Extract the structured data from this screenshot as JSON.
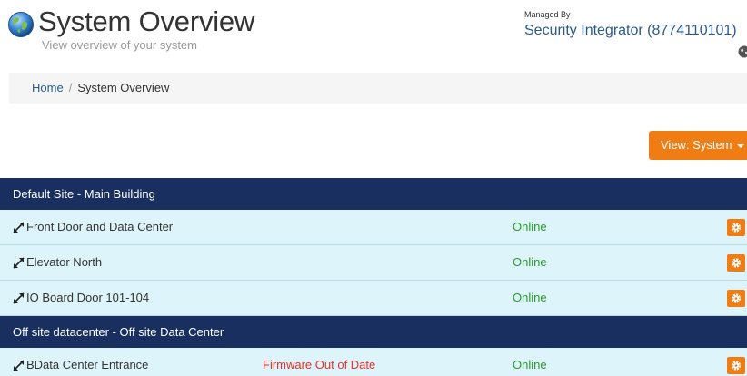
{
  "header": {
    "title": "System Overview",
    "subtitle": "View overview of your system",
    "globe_icon": "globe-icon",
    "managed_by_label": "Managed By",
    "managed_by_name": "Security Integrator (8774110101)",
    "corner_icon": "globe-icon"
  },
  "breadcrumb": {
    "home": "Home",
    "separator": "/",
    "current": "System Overview"
  },
  "view_button": {
    "label": "View: System",
    "icon": "caret-down-icon",
    "color": "#f07d14"
  },
  "colors": {
    "site_header_bg": "#182f5f",
    "row_bg": "#ddf4fa",
    "online": "#2c9a2c",
    "alert": "#e8312a",
    "accent": "#f07d14",
    "link": "#2a5b8a"
  },
  "sites": [
    {
      "name": "Default Site - Main Building",
      "doors": [
        {
          "name": "Front Door and Data Center",
          "alert": "",
          "status": "Online"
        },
        {
          "name": "Elevator North",
          "alert": "",
          "status": "Online"
        },
        {
          "name": "IO Board Door 101-104",
          "alert": "",
          "status": "Online"
        }
      ]
    },
    {
      "name": "Off site datacenter - Off site Data Center",
      "doors": [
        {
          "name": "BData Center Entrance",
          "alert": "Firmware Out of Date",
          "status": "Online"
        }
      ]
    }
  ]
}
